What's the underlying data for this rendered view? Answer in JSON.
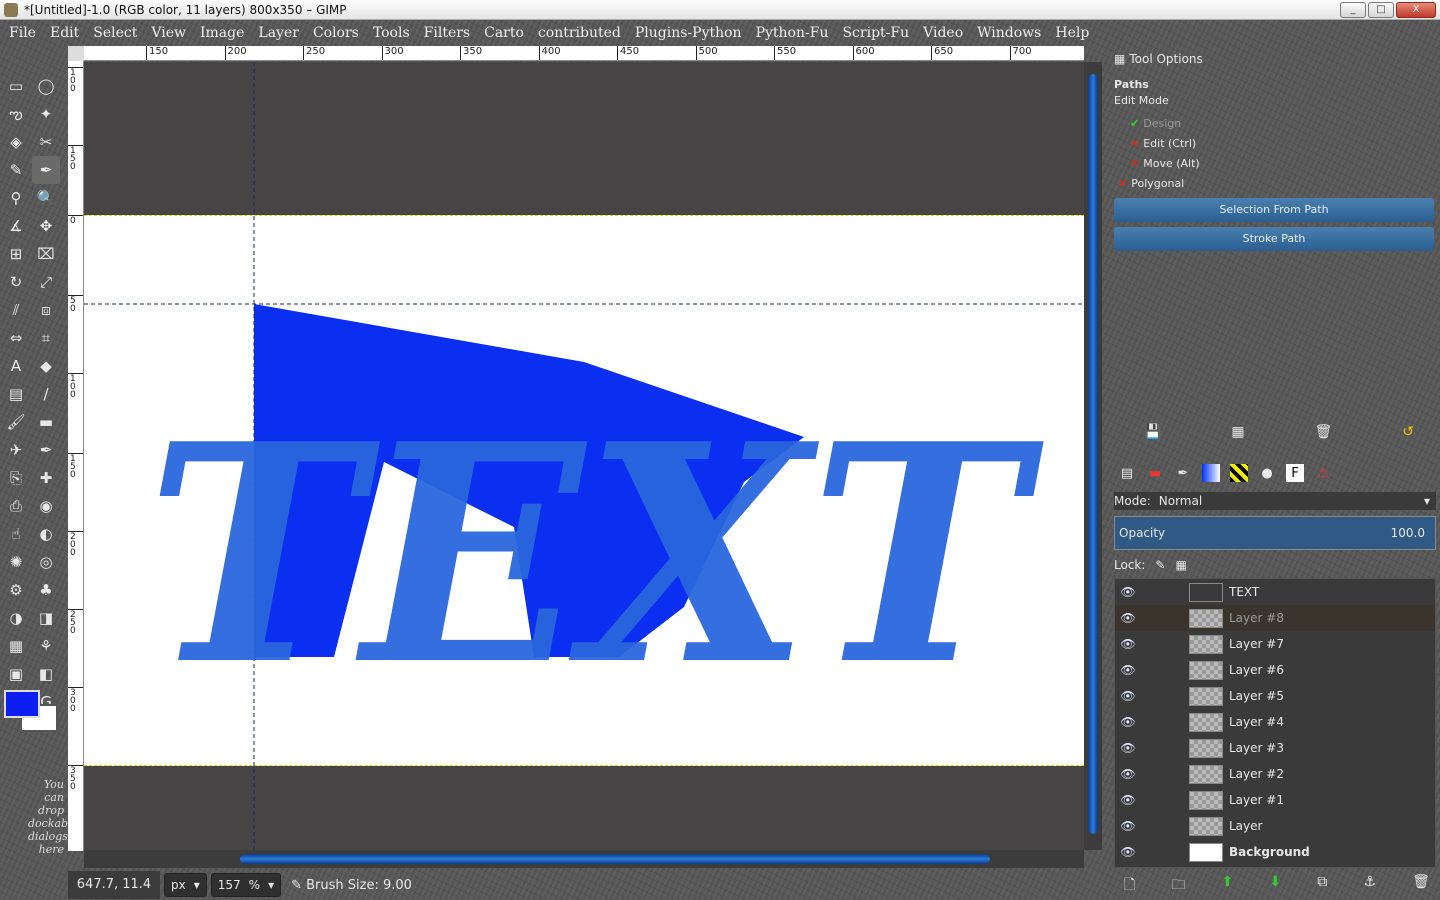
{
  "window": {
    "title": "*[Untitled]-1.0 (RGB color, 11 layers) 800x350 – GIMP",
    "buttons": [
      "_",
      "□",
      "X"
    ]
  },
  "menus": [
    "File",
    "Edit",
    "Select",
    "View",
    "Image",
    "Layer",
    "Colors",
    "Tools",
    "Filters",
    "Carto",
    "contributed",
    "Plugins-Python",
    "Python-Fu",
    "Script-Fu",
    "Video",
    "Windows",
    "Help"
  ],
  "rulers": {
    "h": [
      "150",
      "200",
      "250",
      "300",
      "350",
      "400",
      "450",
      "500",
      "550",
      "600",
      "650",
      "700"
    ],
    "v": [
      "100",
      "150",
      "0",
      "50",
      "100",
      "150",
      "200",
      "250",
      "300",
      "350"
    ]
  },
  "toolbox": {
    "hint": "You can drop dockable dialogs here",
    "tools": [
      "rect-select-icon",
      "ellipse-select-icon",
      "lasso-icon",
      "fuzzy-select-icon",
      "color-select-icon",
      "scissors-icon",
      "foreground-select-icon",
      "paths-icon",
      "color-picker-icon",
      "zoom-icon",
      "measure-icon",
      "move-icon",
      "align-icon",
      "crop-icon",
      "rotate-icon",
      "scale-icon",
      "shear-icon",
      "perspective-icon",
      "flip-icon",
      "cage-icon",
      "text-icon",
      "bucket-fill-icon",
      "blend-icon",
      "pencil-icon",
      "paintbrush-icon",
      "eraser-icon",
      "airbrush-icon",
      "ink-icon",
      "clone-icon",
      "heal-icon",
      "perspective-clone-icon",
      "blur-icon",
      "smudge-icon",
      "dodge-icon",
      "warp-icon",
      "filter-icon",
      "script-icon",
      "color-tool-icon",
      "levels-icon",
      "curves-icon",
      "threshold-icon",
      "gegl-icon",
      "color-balance-icon",
      "hue-icon",
      "grab-icon",
      "g-icon"
    ],
    "tool_glyphs": [
      "▭",
      "◯",
      "ఌ",
      "✦",
      "◈",
      "✂",
      "✎",
      "✒",
      "⚲",
      "🔍",
      "∡",
      "✥",
      "⊞",
      "⌧",
      "↻",
      "⤢",
      "⫽",
      "⧈",
      "⇔",
      "⌗",
      "A",
      "◆",
      "▤",
      "/",
      "🖌",
      "▬",
      "✈",
      "✒",
      "⎘",
      "✚",
      "⎙",
      "◉",
      "☝",
      "◐",
      "✺",
      "◎",
      "⚙",
      "♣",
      "◑",
      "◨",
      "▦",
      "⚘",
      "▣",
      "◧",
      "⚗",
      "G"
    ]
  },
  "canvas": {
    "text": "TEXT"
  },
  "statusbar": {
    "coords": "647.7, 11.4",
    "unit": "px",
    "zoom": "157",
    "zoom_suffix": "%",
    "brush": "Brush Size: 9.00"
  },
  "tool_options": {
    "title": "Tool Options",
    "section": "Paths",
    "edit_mode": "Edit Mode",
    "modes": [
      {
        "label": "Design",
        "state": "ok"
      },
      {
        "label": "Edit (Ctrl)",
        "state": "x"
      },
      {
        "label": "Move (Alt)",
        "state": "x"
      }
    ],
    "polygonal": "Polygonal",
    "selection_btn": "Selection From Path",
    "stroke_btn": "Stroke Path"
  },
  "layers": {
    "mode_label": "Mode:",
    "mode_value": "Normal",
    "opacity_label": "Opacity",
    "opacity_value": "100.0",
    "lock_label": "Lock:",
    "items": [
      {
        "name": "TEXT",
        "thumb": "text"
      },
      {
        "name": "Layer #8",
        "thumb": "checker",
        "selected": true
      },
      {
        "name": "Layer #7",
        "thumb": "checker"
      },
      {
        "name": "Layer #6",
        "thumb": "checker"
      },
      {
        "name": "Layer #5",
        "thumb": "checker"
      },
      {
        "name": "Layer #4",
        "thumb": "checker"
      },
      {
        "name": "Layer #3",
        "thumb": "checker"
      },
      {
        "name": "Layer #2",
        "thumb": "checker"
      },
      {
        "name": "Layer #1",
        "thumb": "checker"
      },
      {
        "name": "Layer",
        "thumb": "checker"
      },
      {
        "name": "Background",
        "thumb": "white",
        "bold": true
      }
    ]
  },
  "colors": {
    "foreground": "#0d1ff0",
    "background": "#ffffff",
    "text_fill": "#2a66dc",
    "shape_fill": "#0a2ff0"
  }
}
